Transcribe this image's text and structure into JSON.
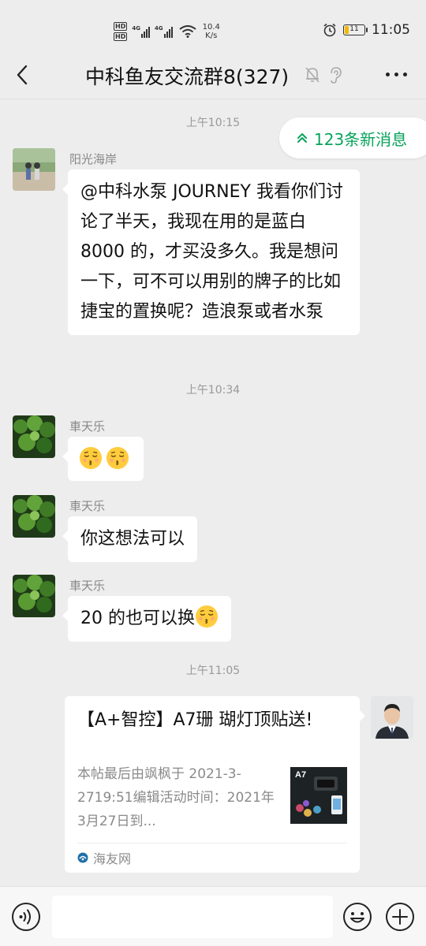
{
  "status_bar": {
    "hd_labels": [
      "HD",
      "HD"
    ],
    "signal_labels": [
      "4G",
      "4G"
    ],
    "net_speed_value": "10.4",
    "net_speed_unit": "K/s",
    "battery_level": "11",
    "time": "11:05",
    "icons": [
      "hd-icon",
      "signal-icon",
      "wifi-icon",
      "alarm-icon",
      "battery-icon"
    ]
  },
  "header": {
    "title": "中科鱼友交流群8(327)",
    "icons": [
      "back-icon",
      "mute-bell-icon",
      "ear-icon",
      "more-icon"
    ]
  },
  "new_messages": {
    "label": "123条新消息",
    "icon": "double-chevron-up-icon",
    "color": "#07a35a"
  },
  "messages": [
    {
      "type": "time",
      "text": "上午10:15"
    },
    {
      "type": "text",
      "sender": "阳光海岸",
      "text": "@中科水泵 JOURNEY  我看你们讨论了半天，我现在用的是蓝白 8000 的，才买没多久。我是想问一下，可不可以用别的牌子的比如捷宝的置换呢？造浪泵或者水泵"
    },
    {
      "type": "time",
      "text": "上午10:34"
    },
    {
      "type": "emoji",
      "sender": "車天乐",
      "emoji": "kissing-face-closed-eyes-emoji",
      "count": 2
    },
    {
      "type": "text",
      "sender": "車天乐",
      "text": "你这想法可以"
    },
    {
      "type": "text",
      "sender": "車天乐",
      "text": "20 的也可以换",
      "emoji": "kissing-face-closed-eyes-emoji"
    },
    {
      "type": "time",
      "text": "上午11:05"
    },
    {
      "type": "link",
      "from": "self",
      "title": "【A+智控】A7珊 瑚灯顶贴送!",
      "desc": "本帖最后由飒枫于 2021-3-2719:51编辑活动时间：2021年3月27日到...",
      "thumb_label": "A7",
      "source": "海友网",
      "source_icon": "haiyou-logo-icon"
    }
  ],
  "input_bar": {
    "value": "",
    "icons": [
      "voice-icon",
      "emoji-icon",
      "plus-icon"
    ]
  }
}
